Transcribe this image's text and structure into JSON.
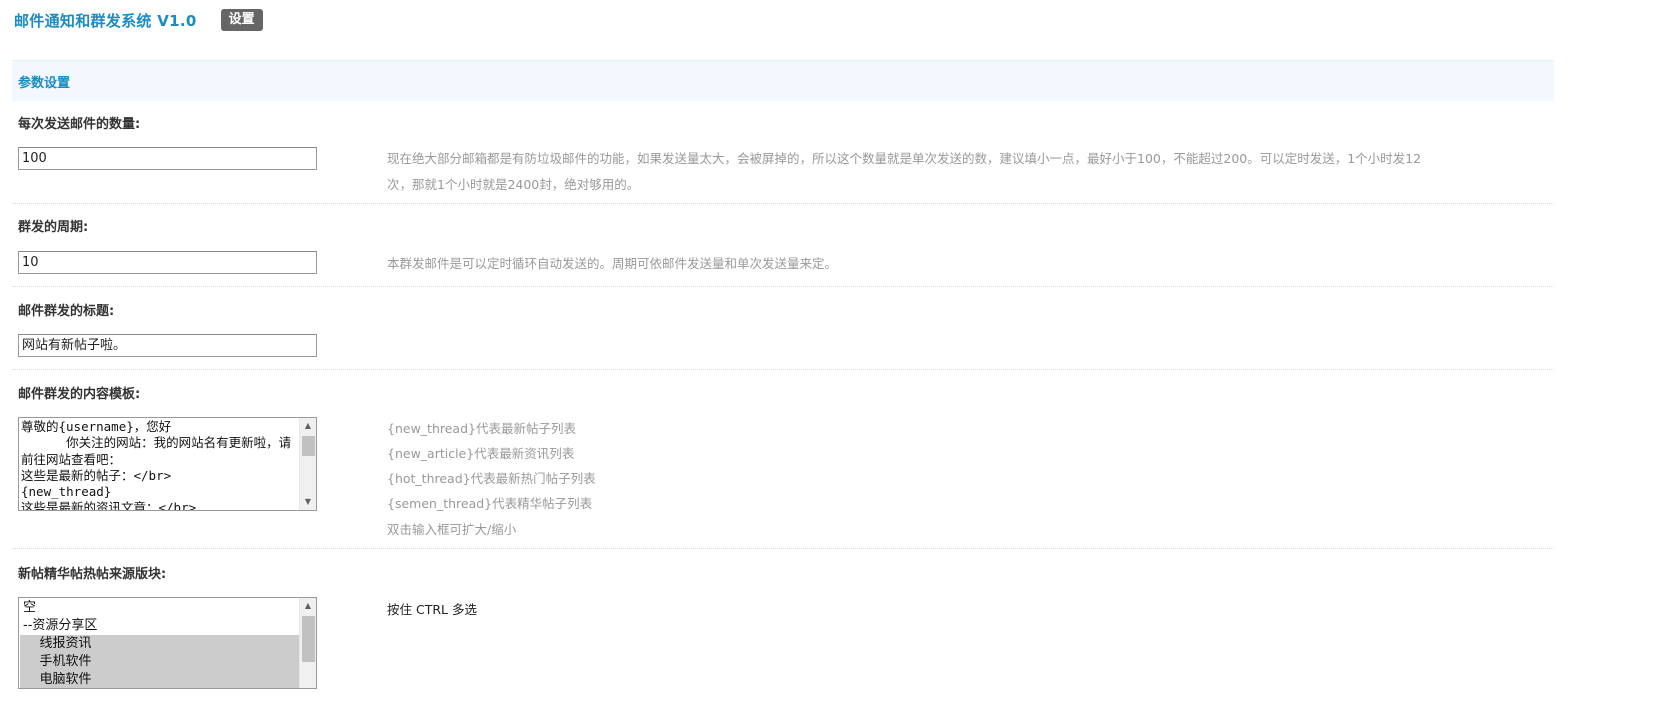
{
  "header": {
    "app_title": "邮件通知和群发系统 V1.0",
    "settings_tab": "设置"
  },
  "section": {
    "title": "参数设置"
  },
  "fields": {
    "send_count": {
      "label": "每次发送邮件的数量:",
      "value": "100",
      "hint_line1": "现在绝大部分邮箱都是有防垃圾邮件的功能，如果发送量太大，会被屏掉的，所以这个数量就是单次发送的数，建议填小一点，最好小于100，不能超过200。可以定时发送，1个小时发12",
      "hint_line2": "次，那就1个小时就是2400封，绝对够用的。"
    },
    "period": {
      "label": "群发的周期:",
      "value": "10",
      "hint": "本群发邮件是可以定时循环自动发送的。周期可依邮件发送量和单次发送量来定。"
    },
    "subject": {
      "label": "邮件群发的标题:",
      "value": "网站有新帖子啦。"
    },
    "template": {
      "label": "邮件群发的内容模板:",
      "value": "尊敬的{username}，您好\n      你关注的网站：我的网站名有更新啦，请前往网站查看吧：\n这些是最新的帖子：</br>\n{new_thread}\n这些是最新的资讯文章：</br>",
      "hints": [
        "{new_thread}代表最新帖子列表",
        "{new_article}代表最新资讯列表",
        "{hot_thread}代表最新热门帖子列表",
        "{semen_thread}代表精华帖子列表",
        "双击输入框可扩大/缩小"
      ]
    },
    "source_boards": {
      "label": "新帖精华帖热帖来源版块:",
      "hint": "按住 CTRL 多选",
      "options": [
        {
          "label": "空",
          "selected": false
        },
        {
          "label": "--资源分享区",
          "selected": false
        },
        {
          "label": "    线报资讯",
          "selected": true
        },
        {
          "label": "    手机软件",
          "selected": true
        },
        {
          "label": "    电脑软件",
          "selected": true
        }
      ]
    }
  }
}
